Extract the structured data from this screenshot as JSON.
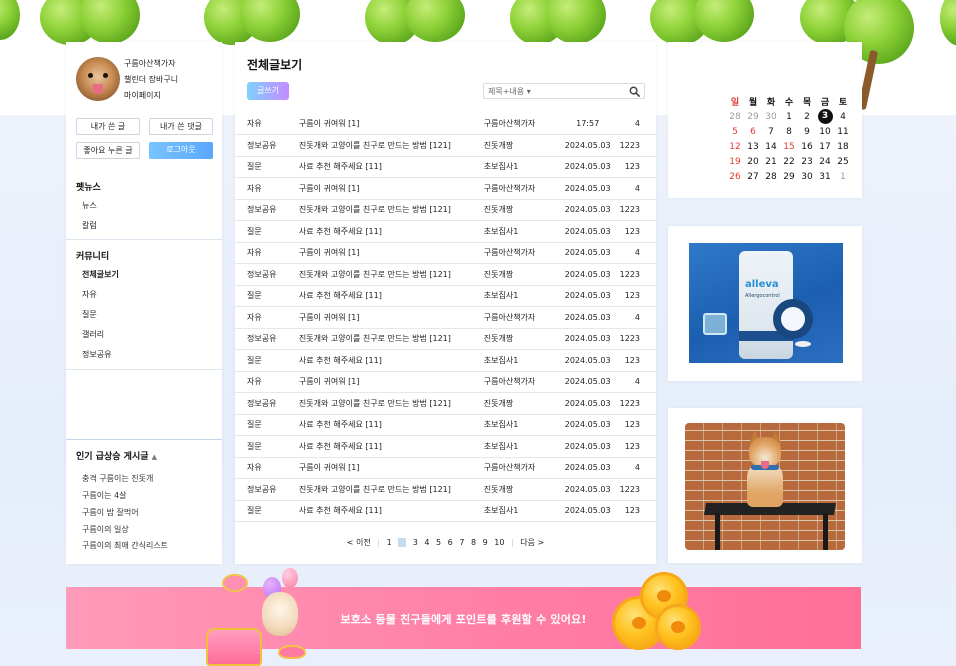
{
  "profile": {
    "nickname": "구름아산책가자",
    "subtitle": "챌린더 장바구니",
    "mypage": "마이페이지",
    "buttons": {
      "my_posts": "내가 쓴 글",
      "my_comments": "내가 쓴 댓글",
      "liked_posts": "좋아요 누른 글",
      "logout": "로그아웃"
    }
  },
  "sidebar": {
    "petnews_title": "펫뉴스",
    "petnews_items": [
      "뉴스",
      "칼럼"
    ],
    "community_title": "커뮤니티",
    "community_items": [
      "전체글보기",
      "자유",
      "질문",
      "갤러리",
      "정보공유"
    ],
    "hot_title": "인기 급상승 게시글",
    "hot_arrow": "▲",
    "hot_items": [
      "충격 구름이는 진돗개",
      "구름이는 4살",
      "구름이 밤 잘먹어",
      "구름이의 일상",
      "구름이의 최애 간식리스트"
    ]
  },
  "main": {
    "title": "전체글보기",
    "write_button": "글쓰기",
    "search_select": "제목+내용",
    "search_placeholder": "",
    "posts": [
      {
        "category": "자유",
        "title": "구름이 귀여워 [1]",
        "author": "구름아산책가자",
        "date": "17:57",
        "count": "4"
      },
      {
        "category": "정보공유",
        "title": "진돗개와 고양이를 친구로 만드는 방법 [121]",
        "author": "진돗개짱",
        "date": "2024.05.03",
        "count": "1223"
      },
      {
        "category": "질문",
        "title": "사료 추천 해주세요 [11]",
        "author": "초보집사1",
        "date": "2024.05.03",
        "count": "123"
      },
      {
        "category": "자유",
        "title": "구름이 귀여워 [1]",
        "author": "구름아산책가자",
        "date": "2024.05.03",
        "count": "4"
      },
      {
        "category": "정보공유",
        "title": "진돗개와 고양이를 친구로 만드는 방법 [121]",
        "author": "진돗개짱",
        "date": "2024.05.03",
        "count": "1223"
      },
      {
        "category": "질문",
        "title": "사료 추천 해주세요 [11]",
        "author": "초보집사1",
        "date": "2024.05.03",
        "count": "123"
      },
      {
        "category": "자유",
        "title": "구름이 귀여워 [1]",
        "author": "구름아산책가자",
        "date": "2024.05.03",
        "count": "4"
      },
      {
        "category": "정보공유",
        "title": "진돗개와 고양이를 친구로 만드는 방법 [121]",
        "author": "진돗개짱",
        "date": "2024.05.03",
        "count": "1223"
      },
      {
        "category": "질문",
        "title": "사료 추천 해주세요 [11]",
        "author": "초보집사1",
        "date": "2024.05.03",
        "count": "123"
      },
      {
        "category": "자유",
        "title": "구름이 귀여워 [1]",
        "author": "구름아산책가자",
        "date": "2024.05.03",
        "count": "4"
      },
      {
        "category": "정보공유",
        "title": "진돗개와 고양이를 친구로 만드는 방법 [121]",
        "author": "진돗개짱",
        "date": "2024.05.03",
        "count": "1223"
      },
      {
        "category": "질문",
        "title": "사료 추천 해주세요 [11]",
        "author": "초보집사1",
        "date": "2024.05.03",
        "count": "123"
      },
      {
        "category": "자유",
        "title": "구름이 귀여워 [1]",
        "author": "구름아산책가자",
        "date": "2024.05.03",
        "count": "4"
      },
      {
        "category": "정보공유",
        "title": "진돗개와 고양이를 친구로 만드는 방법 [121]",
        "author": "진돗개짱",
        "date": "2024.05.03",
        "count": "1223"
      },
      {
        "category": "질문",
        "title": "사료 추천 해주세요 [11]",
        "author": "초보집사1",
        "date": "2024.05.03",
        "count": "123"
      },
      {
        "category": "질문",
        "title": "사료 추천 해주세요 [11]",
        "author": "초보집사1",
        "date": "2024.05.03",
        "count": "123"
      },
      {
        "category": "자유",
        "title": "구름이 귀여워 [1]",
        "author": "구름아산책가자",
        "date": "2024.05.03",
        "count": "4"
      },
      {
        "category": "정보공유",
        "title": "진돗개와 고양이를 친구로 만드는 방법 [121]",
        "author": "진돗개짱",
        "date": "2024.05.03",
        "count": "1223"
      },
      {
        "category": "질문",
        "title": "사료 추천 해주세요 [11]",
        "author": "초보집사1",
        "date": "2024.05.03",
        "count": "123"
      },
      {
        "category": "질문",
        "title": "사료 추천 해주세요 [11]",
        "author": "초보집사1",
        "date": "2024.05.03",
        "count": "123"
      }
    ],
    "pager": {
      "prev": "< 이전",
      "pages": [
        "1",
        "2",
        "3",
        "4",
        "5",
        "6",
        "7",
        "8",
        "9",
        "10"
      ],
      "current": "2",
      "next": "다음 >"
    }
  },
  "calendar": {
    "weekdays": [
      "일",
      "월",
      "화",
      "수",
      "목",
      "금",
      "토"
    ],
    "weeks": [
      [
        "28",
        "29",
        "30",
        "1",
        "2",
        "3",
        "4"
      ],
      [
        "5",
        "6",
        "7",
        "8",
        "9",
        "10",
        "11"
      ],
      [
        "12",
        "13",
        "14",
        "15",
        "16",
        "17",
        "18"
      ],
      [
        "19",
        "20",
        "21",
        "22",
        "23",
        "24",
        "25"
      ],
      [
        "26",
        "27",
        "28",
        "29",
        "30",
        "31",
        "1"
      ]
    ],
    "today": "3",
    "red_dates": [
      "5",
      "6",
      "15"
    ],
    "colors": {
      "sunday": "#e53935",
      "muted": "#9a9a9a",
      "today_bg": "#111111"
    }
  },
  "ads": {
    "ad1_brand": "alleva",
    "ad1_product": "Allergocontrol"
  },
  "banner": {
    "text": "보호소 동물 친구들에게 포인트를 후원할 수 있어요!"
  }
}
